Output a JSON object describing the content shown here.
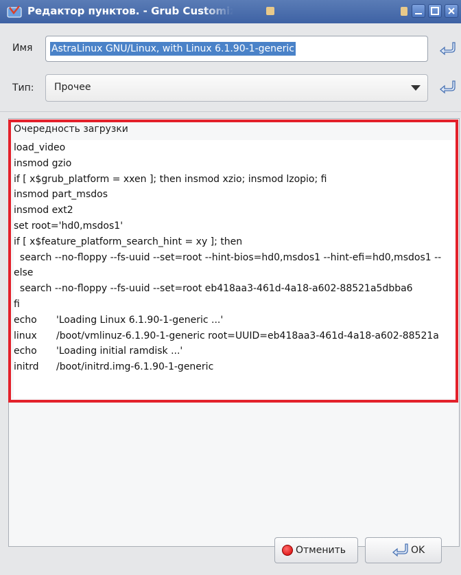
{
  "window": {
    "title": "Редактор пунктов. - Grub Customizer",
    "title_color": "#4a6fb0"
  },
  "form": {
    "name_label": "Имя",
    "name_value": "AstraLinux GNU/Linux, with Linux 6.1.90-1-generic",
    "type_label": "Тип:",
    "type_value": "Прочее"
  },
  "boot_sequence": {
    "header": "Очередность загрузки",
    "highlight_color": "#e3212b",
    "lines": [
      [
        "load_video"
      ],
      [
        "insmod gzio"
      ],
      [
        "if [ x$grub_platform = xxen ]; then insmod xzio; insmod lzopio; fi"
      ],
      [
        "insmod part_msdos"
      ],
      [
        "insmod ext2"
      ],
      [
        "set root='hd0,msdos1'"
      ],
      [
        "if [ x$feature_platform_search_hint = xy ]; then"
      ],
      [
        "  search --no-floppy --fs-uuid --set=root --hint-bios=hd0,msdos1 --hint-efi=hd0,msdos1 --"
      ],
      [
        "else"
      ],
      [
        "  search --no-floppy --fs-uuid --set=root eb418aa3-461d-4a18-a602-88521a5dbba6"
      ],
      [
        "fi"
      ],
      [
        "echo",
        "'Loading Linux 6.1.90-1-generic ...'"
      ],
      [
        "linux",
        "/boot/vmlinuz-6.1.90-1-generic root=UUID=eb418aa3-461d-4a18-a602-88521a"
      ],
      [
        "echo",
        "'Loading initial ramdisk ...'"
      ],
      [
        "initrd",
        "/boot/initrd.img-6.1.90-1-generic"
      ]
    ]
  },
  "buttons": {
    "cancel_label": "Отменить",
    "ok_label": "OK"
  },
  "icons": {
    "app": "app-icon",
    "return": "return-arrow-icon",
    "cancel": "cancel-icon",
    "ok": "ok-return-icon"
  }
}
